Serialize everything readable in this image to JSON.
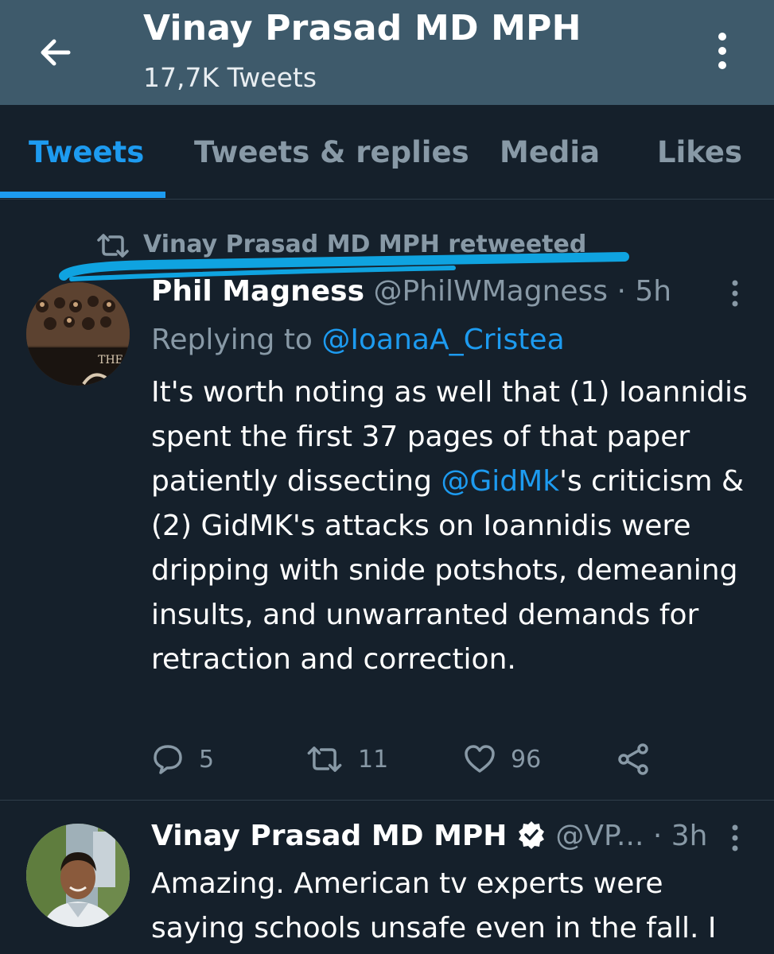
{
  "header": {
    "title": "Vinay Prasad MD MPH",
    "tweet_count": "17,7K Tweets"
  },
  "tabs": [
    {
      "label": "Tweets",
      "active": true
    },
    {
      "label": "Tweets & replies",
      "active": false
    },
    {
      "label": "Media",
      "active": false
    },
    {
      "label": "Likes",
      "active": false
    }
  ],
  "tweets": [
    {
      "retweet_context": "Vinay Prasad MD MPH retweeted",
      "author_name": "Phil Magness",
      "handle": "@PhilWMagness",
      "time": "· 5h",
      "replying_prefix": "Replying to ",
      "replying_to": "@IoanaA_Cristea",
      "body_part1": "It's worth noting as well that (1) Ioannidis spent the first 37 pages of that paper patiently dissecting ",
      "mention": "@GidMk",
      "body_part2": "'s criticism & (2) GidMK's attacks on Ioannidis were dripping with snide potshots, demeaning insults, and unwarranted demands for retraction and correction.",
      "replies": "5",
      "retweets": "11",
      "likes": "96",
      "avatar_text": "THE"
    },
    {
      "author_name": "Vinay Prasad MD MPH",
      "verified": true,
      "handle": "@VP...",
      "time": "· 3h",
      "body": "Amazing. American tv experts were saying schools unsafe even in the fall. I"
    }
  ],
  "colors": {
    "background": "#15202b",
    "header": "#3e5a6b",
    "accent": "#1d9bf0",
    "muted": "#8899a6",
    "scribble": "#0fa3e0"
  },
  "icons": {
    "back": "arrow-left-icon",
    "overflow": "vertical-dots-icon",
    "retweet": "retweet-icon",
    "reply": "comment-icon",
    "like": "heart-icon",
    "share": "share-icon",
    "verified": "verified-badge-icon"
  }
}
